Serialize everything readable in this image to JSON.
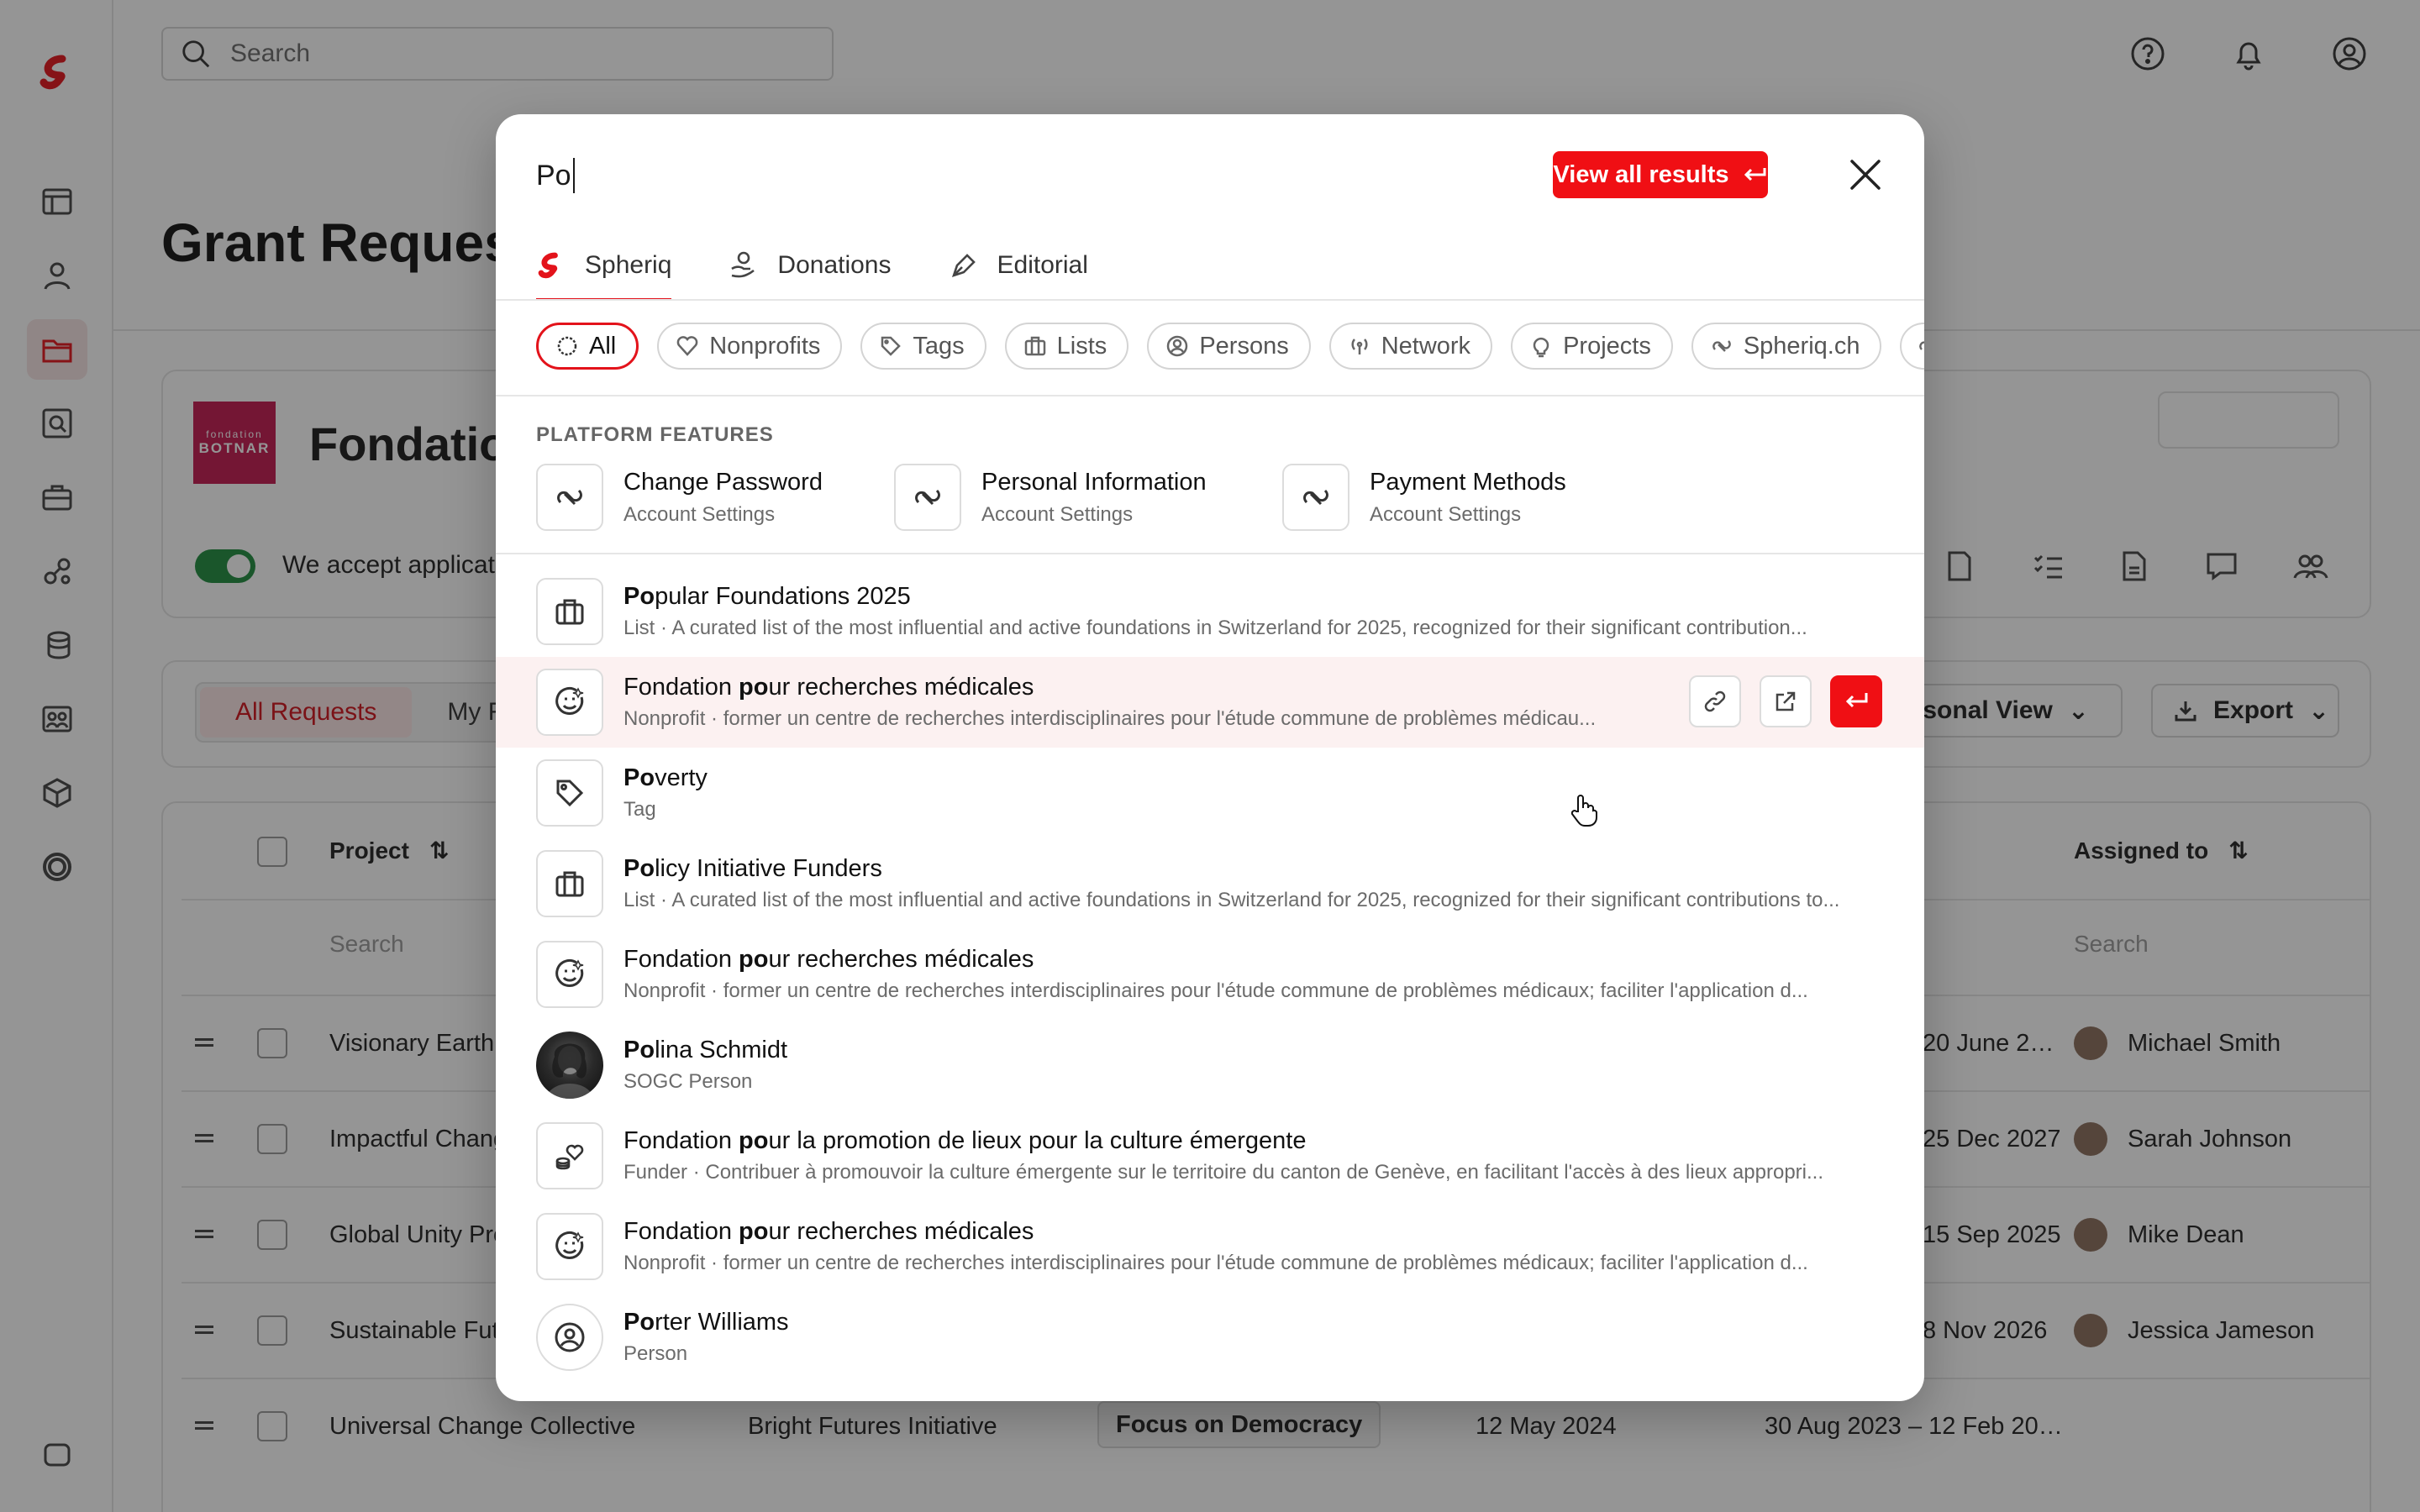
{
  "topbar": {
    "search_placeholder": "Search"
  },
  "page": {
    "title": "Grant Reques"
  },
  "org": {
    "logo_line1": "fondation",
    "logo_line2": "BOTNAR",
    "name": "Fondatio",
    "accept_text": "We accept applicatio"
  },
  "filters": {
    "all_requests": "All Requests",
    "my_requests": "My R",
    "personal_view": "ersonal View",
    "export": "Export"
  },
  "table": {
    "col_project": "Project",
    "col_assigned": "Assigned to",
    "search_placeholder": "Search",
    "rows": [
      {
        "project": "Visionary Earth",
        "date": "20 June 2…",
        "assignee": "Michael Smith"
      },
      {
        "project": "Impactful Chang",
        "date": "25 Dec 2027",
        "assignee": "Sarah Johnson"
      },
      {
        "project": "Global Unity Pro",
        "date": "15 Sep 2025",
        "assignee": "Mike Dean"
      },
      {
        "project": "Sustainable Futu",
        "date": "8 Nov 2026",
        "assignee": "Jessica Jameson"
      },
      {
        "project": "Universal Change Collective",
        "org": "Bright Futures Initiative",
        "tag": "Focus on Democracy",
        "start": "12 May 2024",
        "date": "30 Aug 2023 – 12 Feb 20…"
      }
    ]
  },
  "modal": {
    "query": "Po",
    "view_all": "View all results",
    "tabs": [
      {
        "label": "Spheriq",
        "icon": "spheriq-logo-icon"
      },
      {
        "label": "Donations",
        "icon": "donation-hand-icon"
      },
      {
        "label": "Editorial",
        "icon": "pen-icon"
      }
    ],
    "chips": [
      {
        "label": "All",
        "icon": "circle-icon"
      },
      {
        "label": "Nonprofits",
        "icon": "heart-icon"
      },
      {
        "label": "Tags",
        "icon": "tag-icon"
      },
      {
        "label": "Lists",
        "icon": "briefcase-icon"
      },
      {
        "label": "Persons",
        "icon": "person-icon"
      },
      {
        "label": "Network",
        "icon": "broadcast-icon"
      },
      {
        "label": "Projects",
        "icon": "lightbulb-icon"
      },
      {
        "label": "Spheriq.ch",
        "icon": "spheriq-icon"
      }
    ],
    "section_label": "PLATFORM FEATURES",
    "features": [
      {
        "title": "Change Password",
        "sub": "Account Settings"
      },
      {
        "title": "Personal Information",
        "sub": "Account Settings"
      },
      {
        "title": "Payment Methods",
        "sub": "Account Settings"
      }
    ],
    "results": [
      {
        "hl": "Po",
        "rest": "pular Foundations 2025",
        "sub": "List  ·  A curated list of the most influential and active foundations in Switzerland for 2025, recognized for their significant contribution...",
        "icon": "briefcase-icon"
      },
      {
        "pre": "Fondation ",
        "hl": "po",
        "rest": "ur recherches médicales",
        "sub": "Nonprofit  ·  former un centre de recherches interdisciplinaires pour l'étude commune de problèmes médicau...",
        "icon": "smile-face-icon"
      },
      {
        "hl": "Po",
        "rest": "verty",
        "sub": "Tag",
        "icon": "tag-icon"
      },
      {
        "hl": "Po",
        "rest": "licy Initiative Funders",
        "sub": "List  ·  A curated list of the most influential and active foundations in Switzerland for 2025, recognized for their significant contributions to...",
        "icon": "briefcase-icon"
      },
      {
        "pre": "Fondation ",
        "hl": "po",
        "rest": "ur recherches médicales",
        "sub": "Nonprofit  ·  former un centre de recherches interdisciplinaires pour l'étude commune de problèmes médicaux; faciliter l'application d...",
        "icon": "smile-face-icon"
      },
      {
        "hl": "Po",
        "rest": "lina Schmidt",
        "sub": "SOGC Person",
        "icon": "avatar-photo"
      },
      {
        "pre": "Fondation ",
        "hl": "po",
        "rest": "ur la promotion de lieux pour la culture émergente",
        "sub": "Funder  ·  Contribuer à promouvoir la culture émergente sur le territoire du canton de Genève, en facilitant l'accès à des lieux appropri...",
        "icon": "coins-heart-icon"
      },
      {
        "pre": "Fondation ",
        "hl": "po",
        "rest": "ur recherches médicales",
        "sub": "Nonprofit  ·  former un centre de recherches interdisciplinaires pour l'étude commune de problèmes médicaux; faciliter l'application d...",
        "icon": "smile-face-icon"
      },
      {
        "hl": "Po",
        "rest": "rter Williams",
        "sub": "Person",
        "icon": "person-circle-icon"
      }
    ],
    "colors": {
      "accent": "#f00f14",
      "hover_row": "#fcf1f1"
    }
  }
}
